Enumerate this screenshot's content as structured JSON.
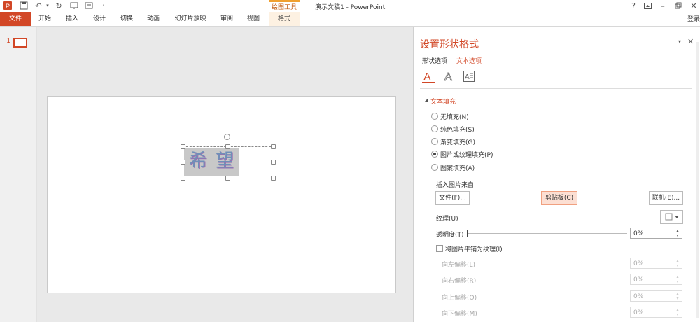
{
  "window": {
    "title": "演示文稿1 - PowerPoint",
    "contextual_group": "绘图工具",
    "signin": "登录",
    "help": "?"
  },
  "ribbon": {
    "tabs": [
      "文件",
      "开始",
      "插入",
      "设计",
      "切换",
      "动画",
      "幻灯片放映",
      "审阅",
      "视图",
      "格式"
    ]
  },
  "thumbnails": {
    "slide_number": "1"
  },
  "slide": {
    "picture_text": "希望"
  },
  "pane": {
    "title": "设置形状格式",
    "tab_shape": "形状选项",
    "tab_text": "文本选项",
    "section_title": "文本填充",
    "fill_options": [
      "无填充(N)",
      "纯色填充(S)",
      "渐变填充(G)",
      "图片或纹理填充(P)",
      "图案填充(A)"
    ],
    "selected_fill": 3,
    "insert_from_label": "插入图片来自",
    "file_button": "文件(F)...",
    "clipboard_button": "剪贴板(C)",
    "online_button": "联机(E)...",
    "texture_label": "纹理(U)",
    "transparency_label": "透明度(T)",
    "transparency_value": "0%",
    "tile_label": "将图片平铺为纹理(I)",
    "offsets": [
      {
        "label": "向左偏移(L)",
        "value": "0%"
      },
      {
        "label": "向右偏移(R)",
        "value": "0%"
      },
      {
        "label": "向上偏移(O)",
        "value": "0%"
      },
      {
        "label": "向下偏移(M)",
        "value": "0%"
      }
    ]
  },
  "colors": {
    "accent": "#d24726",
    "contextual": "#f0a030"
  }
}
